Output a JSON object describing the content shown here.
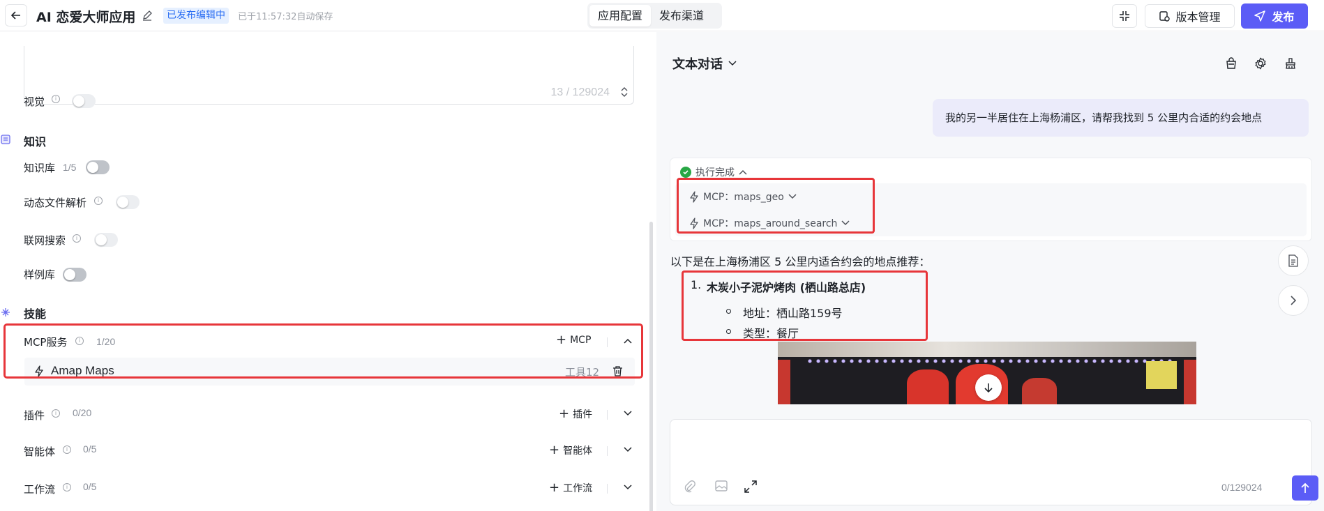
{
  "header": {
    "title": "AI 恋爱大师应用",
    "status_badge": "已发布编辑中",
    "autosave": "已于11:57:32自动保存",
    "tabs": [
      {
        "label": "应用配置",
        "active": true
      },
      {
        "label": "发布渠道",
        "active": false
      }
    ],
    "version_label": "版本管理",
    "publish_label": "发布"
  },
  "config": {
    "prompt_count": "13 / 129024",
    "vision_label": "视觉",
    "knowledge_section": "知识",
    "knowledge_base_label": "知识库",
    "knowledge_base_count": "1/5",
    "dynamic_file_label": "动态文件解析",
    "web_search_label": "联网搜索",
    "example_lib_label": "样例库",
    "skills_section": "技能",
    "mcp": {
      "label": "MCP服务",
      "count": "1/20",
      "add_label": "MCP",
      "item": {
        "name": "Amap Maps",
        "tools": "工具12"
      }
    },
    "plugin": {
      "label": "插件",
      "count": "0/20",
      "add_label": "插件"
    },
    "agent": {
      "label": "智能体",
      "count": "0/5",
      "add_label": "智能体"
    },
    "workflow": {
      "label": "工作流",
      "count": "0/5",
      "add_label": "工作流"
    }
  },
  "chat": {
    "mode_label": "文本对话",
    "user_message": "我的另一半居住在上海杨浦区，请帮我找到 5 公里内合适的约会地点",
    "exec_status": "执行完成",
    "exec_calls": [
      "MCP：maps_geo",
      "MCP：maps_around_search"
    ],
    "answer_intro": "以下是在上海杨浦区 5 公里内适合约会的地点推荐：",
    "result": {
      "number": "1.",
      "name": "木炭小子泥炉烤肉 (栖山路总店)",
      "address": "地址：栖山路159号",
      "type": "类型：餐厅"
    },
    "input_count": "0/129024"
  },
  "colors": {
    "accent": "#5b5cf6",
    "highlight_box": "#e7363a",
    "badge_bg": "#e6f0ff",
    "badge_text": "#2b6ef3",
    "success": "#28a745"
  },
  "icons": [
    "back-arrow-icon",
    "edit-pencil-icon",
    "shrink-icon",
    "version-icon",
    "send-plane-icon",
    "info-icon",
    "knowledge-icon",
    "skills-icon",
    "chevron-up-icon",
    "chevron-down-icon",
    "lightning-icon",
    "trash-icon",
    "bag-icon",
    "gear-icon",
    "broom-icon",
    "check-circle-icon",
    "document-icon",
    "chevron-right-icon",
    "arrow-down-icon",
    "paperclip-icon",
    "image-icon",
    "expand-icon",
    "arrow-up-icon"
  ]
}
